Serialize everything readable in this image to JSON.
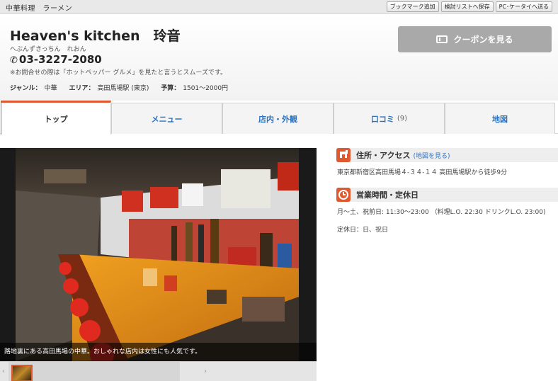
{
  "topbar": {
    "genre": "中華料理　ラーメン",
    "actions": [
      "ブックマーク追加",
      "検討リストへ保存",
      "PC･ケータイへ送る"
    ]
  },
  "shop": {
    "name": "Heaven's kitchen　玲音",
    "kana": "へぶんずきっちん　れおん",
    "phone": "03-3227-2080",
    "phone_note": "※お問合せの際は「ホットペッパー グルメ」を見たと言うとスムーズです。",
    "genre_label": "ジャンル：",
    "genre_value": "中華",
    "area_label": "エリア：",
    "area_value": "高田馬場駅 (東京)",
    "budget_label": "予算：",
    "budget_value": "1501～2000円"
  },
  "coupon": {
    "label": "クーポンを見る",
    "icon": "coupon-icon"
  },
  "tabs": [
    {
      "label": "トップ",
      "count": ""
    },
    {
      "label": "メニュー",
      "count": ""
    },
    {
      "label": "店内・外観",
      "count": ""
    },
    {
      "label": "口コミ",
      "count": "(9)"
    },
    {
      "label": "地図",
      "count": ""
    }
  ],
  "photo": {
    "caption": "路地裏にある高田馬場の中華。おしゃれな店内は女性にも人気です。"
  },
  "access": {
    "title": "住所・アクセス",
    "link": "(地図を見る)",
    "text": "東京都新宿区高田馬場４-３４-１４ 高田馬場駅から徒歩9分"
  },
  "hours": {
    "title": "営業時間・定休日",
    "text": "月～土、祝前日: 11:30～23:00 （料理L.O. 22:30 ドリンクL.O. 23:00)",
    "closed": "定休日：日、祝日"
  },
  "colors": {
    "accent": "#e0582f",
    "link": "#2a73c4",
    "coupon_bg": "#a9a9a9"
  }
}
